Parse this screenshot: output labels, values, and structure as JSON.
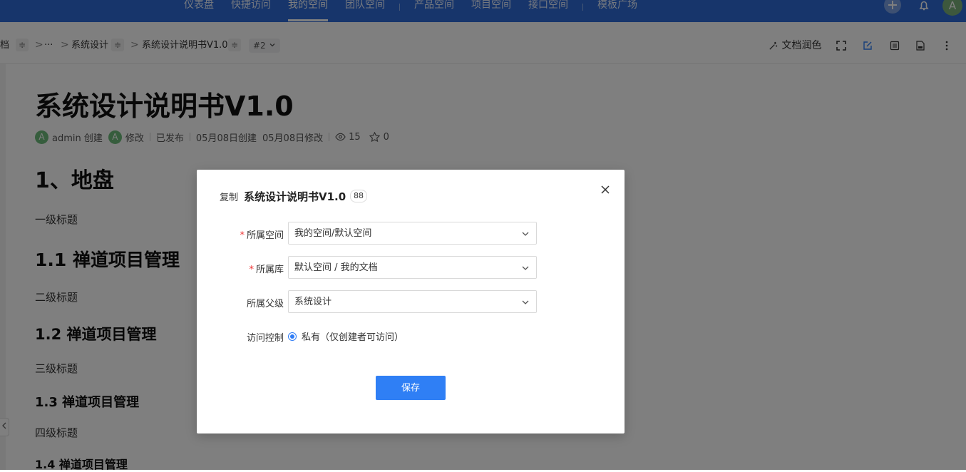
{
  "nav": {
    "items": [
      "仪表盘",
      "快捷访问",
      "我的空间",
      "团队空间",
      "产品空间",
      "项目空间",
      "接口空间",
      "模板广场"
    ],
    "active": "我的空间",
    "add_icon": "plus-icon",
    "bell_icon": "bell-icon",
    "avatar": "A"
  },
  "breadcrumb": {
    "lib": "档",
    "swap": "≑",
    "ellipsis": "···",
    "parent": "系统设计",
    "doc": "系统设计说明书V1.0",
    "version": "#2",
    "chevron": ">"
  },
  "toolbar": {
    "polish_label": "文档润色",
    "icons": [
      "magic-wand-icon",
      "fullscreen-icon",
      "edit-icon",
      "outline-icon",
      "export-icon",
      "more-icon"
    ]
  },
  "doc": {
    "title": "系统设计说明书V1.0",
    "meta": {
      "creator_avatar": "A",
      "creator": "admin 创建",
      "editor_avatar": "A",
      "editor": "修改",
      "status": "已发布",
      "created": "05月08日创建",
      "modified": "05月08日修改",
      "views": "15",
      "stars": "0"
    },
    "h1": "1、地盘",
    "p1": "一级标题",
    "h2": "1.1 禅道项目管理",
    "p2": "二级标题",
    "h3": "1.2 禅道项目管理",
    "p3": "三级标题",
    "h4": "1.3 禅道项目管理",
    "p4": "四级标题",
    "h5": "1.4 禅道项目管理"
  },
  "modal": {
    "prefix": "复制",
    "title": "系统设计说明书V1.0",
    "badge": "88",
    "fields": [
      {
        "label": "所属空间",
        "required": true,
        "value": "我的空间/默认空间"
      },
      {
        "label": "所属库",
        "required": true,
        "value": "默认空间 / 我的文档"
      },
      {
        "label": "所属父级",
        "required": false,
        "value": "系统设计"
      }
    ],
    "access_label": "访问控制",
    "access_option": "私有（仅创建者可访问）",
    "save_label": "保存",
    "required_mark": "*"
  },
  "colors": {
    "nav_bg": "#2e6bd6",
    "primary": "#2f7ff5",
    "required": "#e33333"
  }
}
